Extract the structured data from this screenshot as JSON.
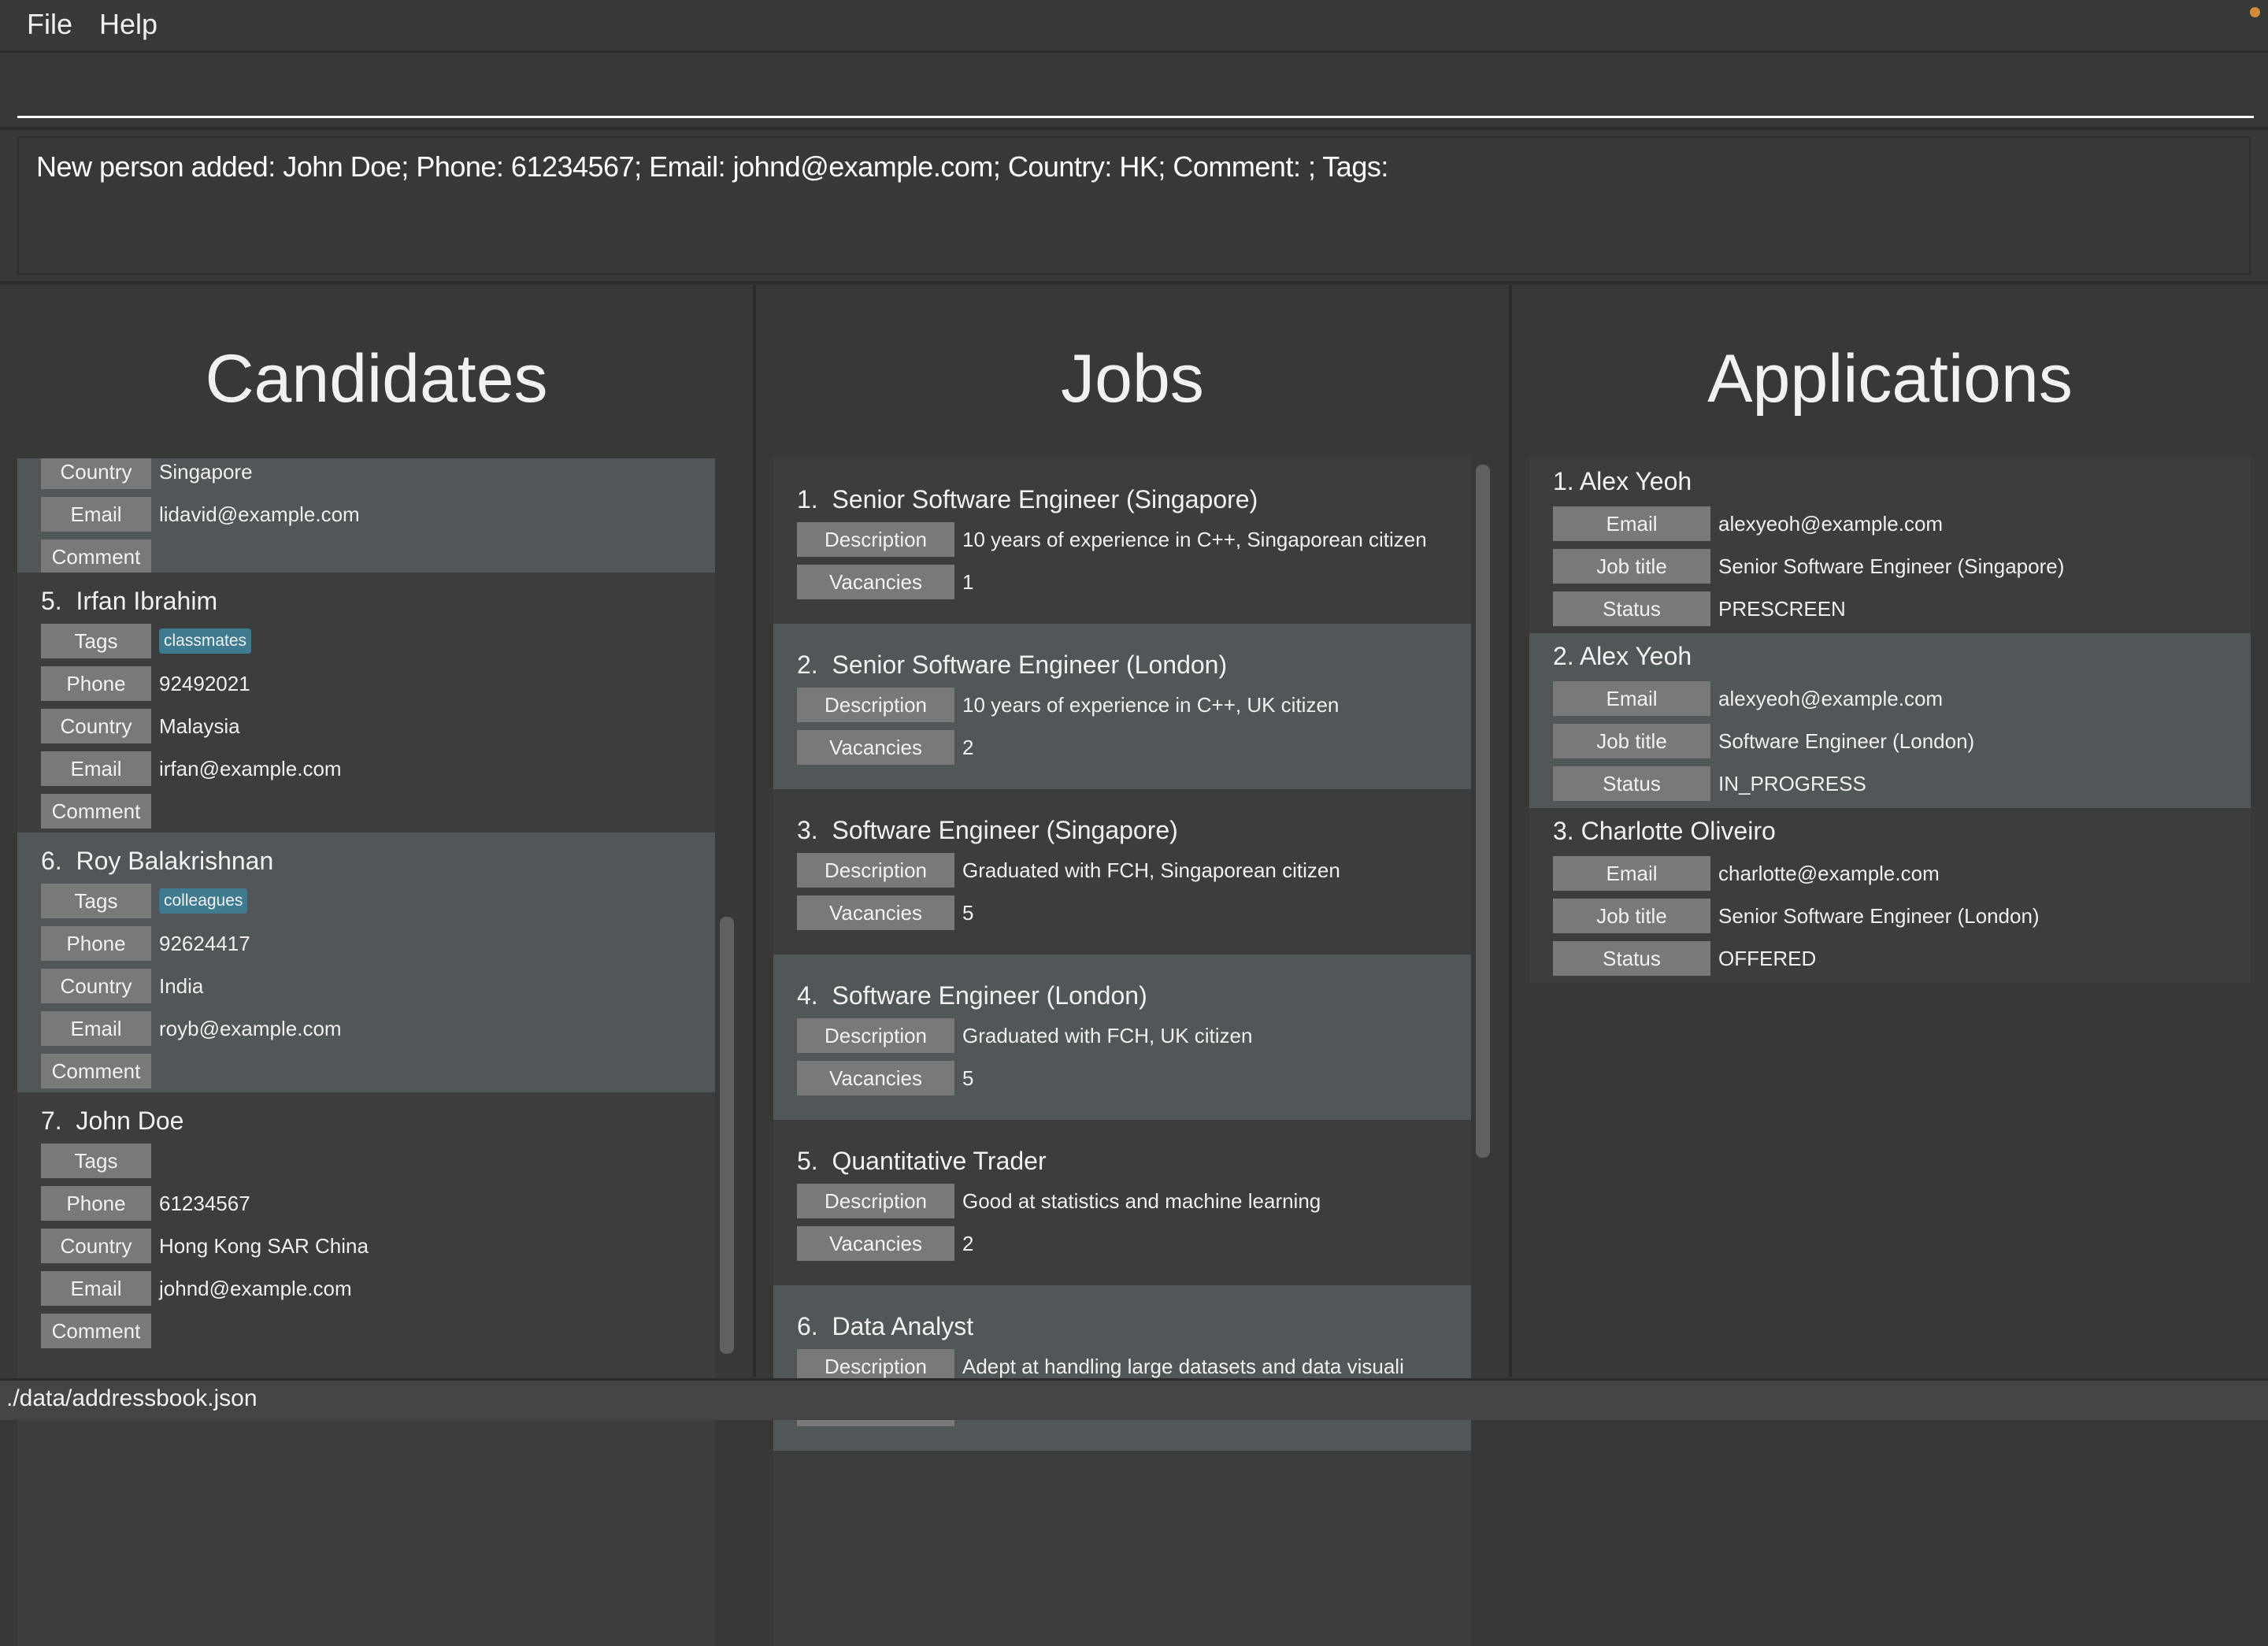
{
  "menu": {
    "items": [
      "File",
      "Help"
    ]
  },
  "command_box": {
    "value": "",
    "placeholder": ""
  },
  "result_display": {
    "text": "New person added: John Doe; Phone: 61234567; Email: johnd@example.com; Country: HK; Comment: ; Tags:"
  },
  "colors": {
    "background": "#383838",
    "list_background": "#3c3d3f",
    "alternate_row": "#515658",
    "label_background": "#797979",
    "tag_background": "#3e7b91",
    "status_bar": "#444444",
    "notification_dot": "#d28d3a"
  },
  "candidates": {
    "title": "Candidates",
    "partial_card": {
      "fields": [
        {
          "label": "Country",
          "value": "Singapore"
        },
        {
          "label": "Email",
          "value": "lidavid@example.com"
        },
        {
          "label": "Comment",
          "value": ""
        }
      ]
    },
    "items": [
      {
        "index": "5.",
        "name": "Irfan Ibrahim",
        "tags": [
          "classmates"
        ],
        "tags_label": "Tags",
        "fields": [
          {
            "label": "Phone",
            "value": "92492021"
          },
          {
            "label": "Country",
            "value": "Malaysia"
          },
          {
            "label": "Email",
            "value": "irfan@example.com"
          },
          {
            "label": "Comment",
            "value": ""
          }
        ]
      },
      {
        "index": "6.",
        "name": "Roy Balakrishnan",
        "tags": [
          "colleagues"
        ],
        "tags_label": "Tags",
        "fields": [
          {
            "label": "Phone",
            "value": "92624417"
          },
          {
            "label": "Country",
            "value": "India"
          },
          {
            "label": "Email",
            "value": "royb@example.com"
          },
          {
            "label": "Comment",
            "value": ""
          }
        ]
      },
      {
        "index": "7.",
        "name": "John Doe",
        "tags": [],
        "tags_label": "Tags",
        "fields": [
          {
            "label": "Phone",
            "value": "61234567"
          },
          {
            "label": "Country",
            "value": "Hong Kong SAR China"
          },
          {
            "label": "Email",
            "value": "johnd@example.com"
          },
          {
            "label": "Comment",
            "value": ""
          }
        ]
      }
    ]
  },
  "jobs": {
    "title": "Jobs",
    "description_label": "Description",
    "vacancies_label": "Vacancies",
    "items": [
      {
        "index": "1.",
        "title": "Senior Software Engineer (Singapore)",
        "description": "10 years of experience in C++, Singaporean citizen",
        "vacancies": "1"
      },
      {
        "index": "2.",
        "title": "Senior Software Engineer (London)",
        "description": "10 years of experience in C++, UK citizen",
        "vacancies": "2"
      },
      {
        "index": "3.",
        "title": "Software Engineer (Singapore)",
        "description": "Graduated with FCH, Singaporean citizen",
        "vacancies": "5"
      },
      {
        "index": "4.",
        "title": "Software Engineer (London)",
        "description": "Graduated with FCH, UK citizen",
        "vacancies": "5"
      },
      {
        "index": "5.",
        "title": "Quantitative Trader",
        "description": "Good at statistics and machine learning",
        "vacancies": "2"
      },
      {
        "index": "6.",
        "title": "Data Analyst",
        "description": "Adept at handling large datasets and data visuali",
        "vacancies": ""
      }
    ]
  },
  "applications": {
    "title": "Applications",
    "email_label": "Email",
    "job_title_label": "Job title",
    "status_label": "Status",
    "items": [
      {
        "index": "1.",
        "name": "Alex Yeoh",
        "email": "alexyeoh@example.com",
        "job_title": "Senior Software Engineer (Singapore)",
        "status": "PRESCREEN"
      },
      {
        "index": "2.",
        "name": "Alex Yeoh",
        "email": "alexyeoh@example.com",
        "job_title": "Software Engineer (London)",
        "status": "IN_PROGRESS"
      },
      {
        "index": "3.",
        "name": "Charlotte Oliveiro",
        "email": "charlotte@example.com",
        "job_title": "Senior Software Engineer (London)",
        "status": "OFFERED"
      }
    ]
  },
  "status_bar": {
    "path": "./data/addressbook.json"
  }
}
